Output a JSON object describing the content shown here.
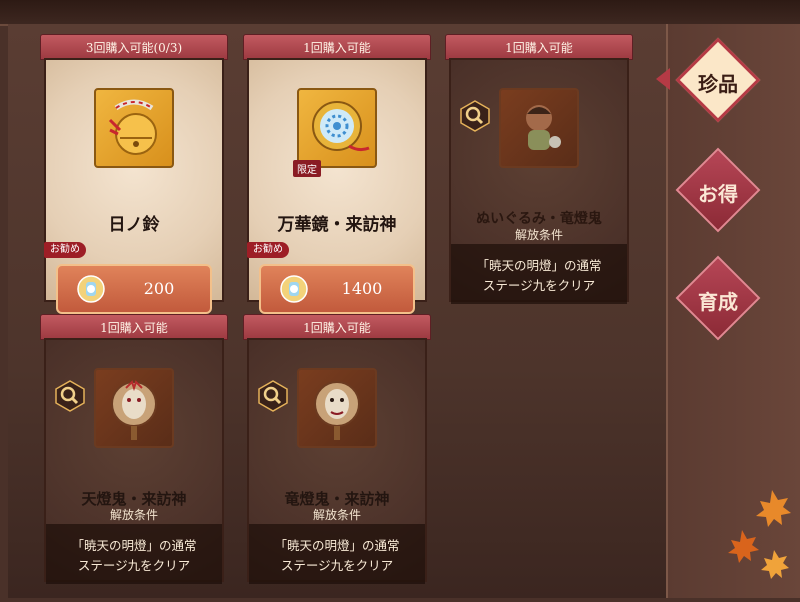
{
  "cards": [
    {
      "header": "3回購入可能(0/3)",
      "name": "日ノ鈴",
      "recommend": "お勧め",
      "price": "200",
      "icon": "bell-icon"
    },
    {
      "header": "1回購入可能",
      "name": "万華鏡・来訪神",
      "recommend": "お勧め",
      "price": "1400",
      "limited": "限定",
      "icon": "kaleidoscope-mirror-icon"
    },
    {
      "header": "1回購入可能",
      "name": "ぬいぐるみ・竜燈鬼",
      "lock_title": "解放条件",
      "lock_text": "「暁天の明燈」の通常\nステージ九をクリア",
      "icon": "plush-doll-icon"
    },
    {
      "header": "1回購入可能",
      "name": "天燈鬼・来訪神",
      "lock_title": "解放条件",
      "lock_text": "「暁天の明燈」の通常\nステージ九をクリア",
      "icon": "mask-mirror-icon"
    },
    {
      "header": "1回購入可能",
      "name": "竜燈鬼・来訪神",
      "lock_title": "解放条件",
      "lock_text": "「暁天の明燈」の通常\nステージ九をクリア",
      "icon": "mask-mirror-icon"
    }
  ],
  "tabs": [
    {
      "label": "珍品",
      "active": true
    },
    {
      "label": "お得",
      "active": false
    },
    {
      "label": "育成",
      "active": false
    }
  ],
  "colors": {
    "header_red": "#b44a52",
    "accent_gold": "#e5a43a",
    "background": "#4a3129"
  }
}
